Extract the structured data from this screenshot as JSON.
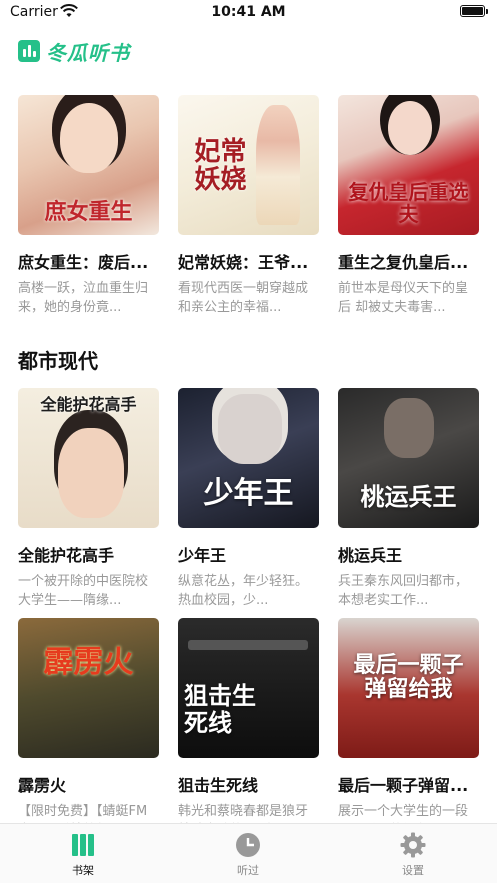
{
  "status": {
    "carrier": "Carrier",
    "time": "10:41 AM"
  },
  "app": {
    "name": "冬瓜听书",
    "brand_color": "#25c089"
  },
  "featured": [
    {
      "cover_text": "庶女重生",
      "title": "庶女重生：废后...",
      "desc": "高楼一跃，泣血重生归来，她的身份竟..."
    },
    {
      "cover_text": "妃常妖娆",
      "title": "妃常妖娆：王爷...",
      "desc": "看现代西医一朝穿越成和亲公主的幸福..."
    },
    {
      "cover_text": "复仇皇后重选夫",
      "title": "重生之复仇皇后...",
      "desc": "前世本是母仪天下的皇后 却被丈夫毒害..."
    }
  ],
  "section": {
    "title": "都市现代"
  },
  "urban": [
    {
      "cover_text": "全能护花高手",
      "title": "全能护花高手",
      "desc": "一个被开除的中医院校大学生——隋缘..."
    },
    {
      "cover_text": "少年王",
      "title": "少年王",
      "desc": "纵意花丛，年少轻狂。热血校园，少..."
    },
    {
      "cover_text": "桃运兵王",
      "title": "桃运兵王",
      "desc": "兵王秦东风回归都市，本想老实工作..."
    },
    {
      "cover_text": "霹雳火",
      "title": "霹雳火",
      "desc": "【限时免费】【蜻蜓FM出品】看特战部..."
    },
    {
      "cover_text": "狙击生死线",
      "title": "狙击生死线",
      "desc": "韩光和蔡晓春都是狼牙特种大队的*狙击..."
    },
    {
      "cover_text": "最后一颗子弹留给我",
      "title": "最后一颗子弹留...",
      "desc": "展示一个大学生的一段异于常人的绿色..."
    }
  ],
  "tabs": [
    {
      "label": "书架",
      "icon": "bookshelf-icon",
      "active": true
    },
    {
      "label": "听过",
      "icon": "clock-icon",
      "active": false
    },
    {
      "label": "设置",
      "icon": "gear-icon",
      "active": false
    }
  ]
}
